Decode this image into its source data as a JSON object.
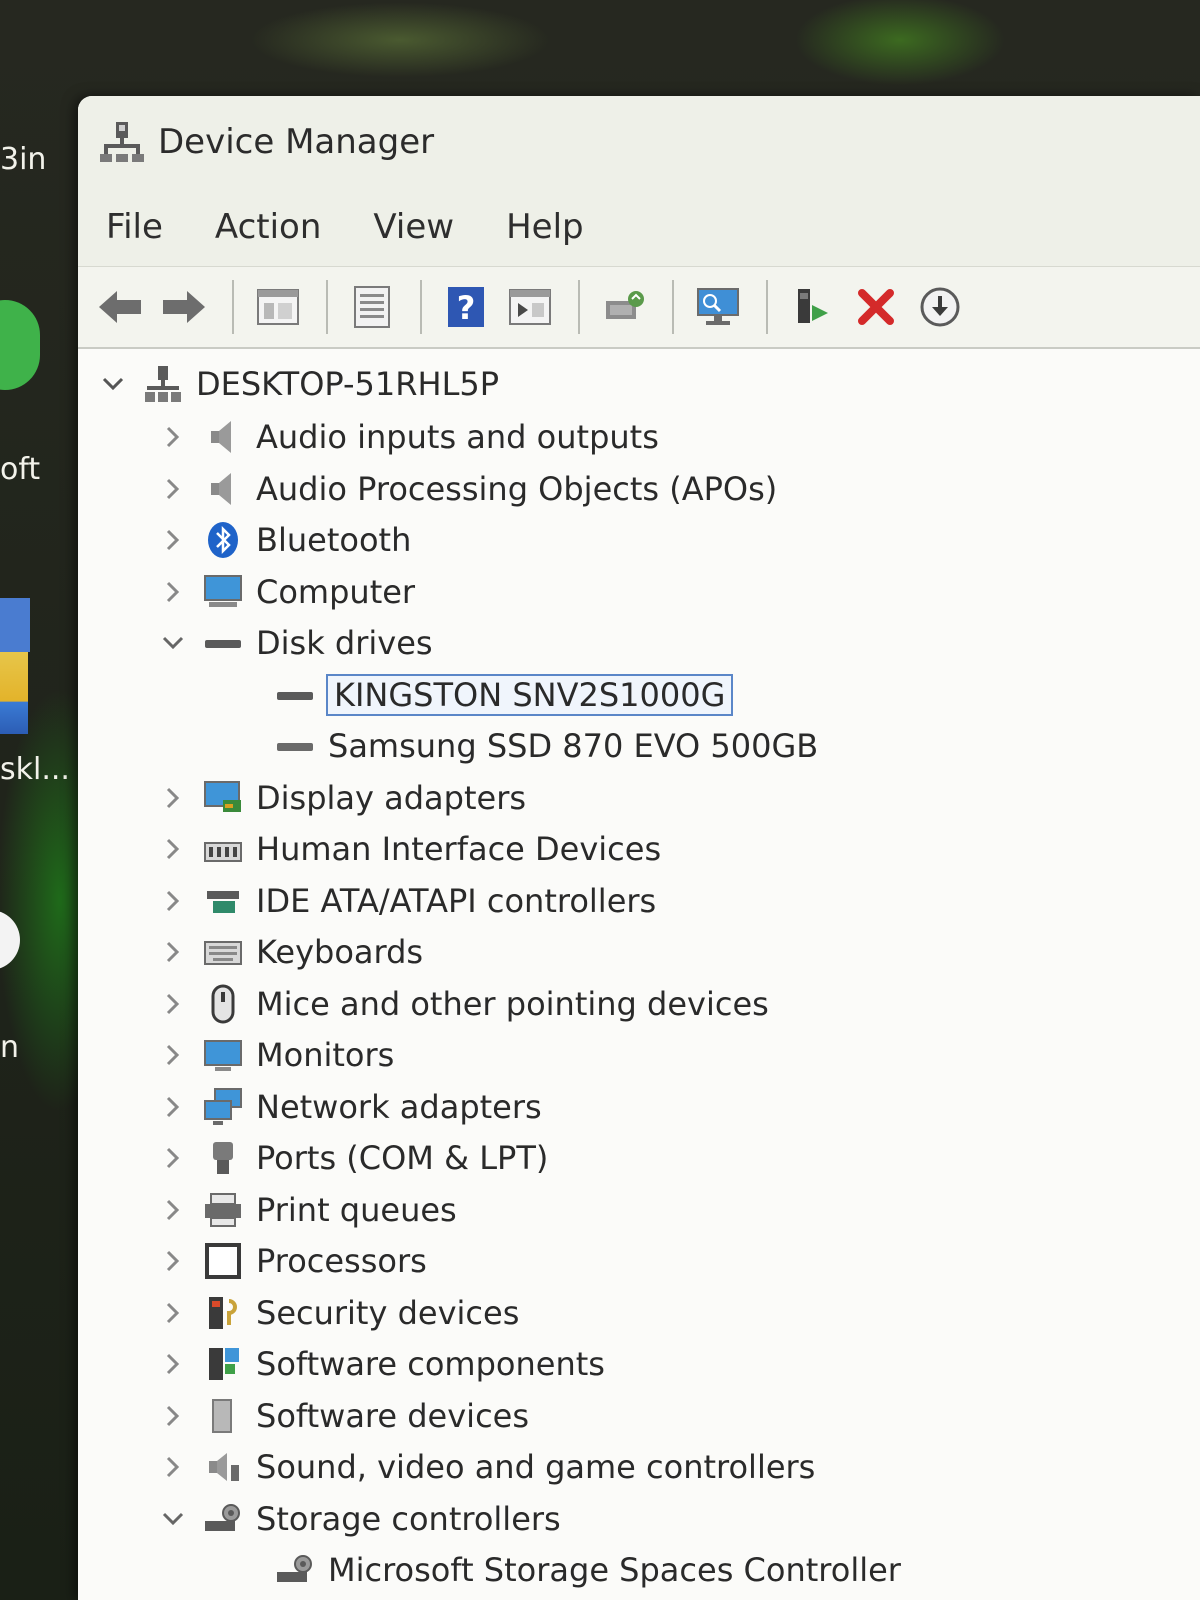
{
  "desktop": {
    "labels": [
      "3in",
      "oft",
      "skl...",
      "n"
    ]
  },
  "window": {
    "title": "Device Manager"
  },
  "menu": {
    "file": "File",
    "action": "Action",
    "view": "View",
    "help": "Help"
  },
  "toolbar": {
    "icons": [
      "back-arrow-icon",
      "forward-arrow-icon",
      "show-hide-tree-icon",
      "properties-icon",
      "help-icon",
      "run-icon",
      "update-driver-icon",
      "scan-hardware-icon",
      "add-legacy-icon",
      "uninstall-icon",
      "download-icon"
    ]
  },
  "tree": {
    "root": "DESKTOP-51RHL5P",
    "items": [
      {
        "label": "Audio inputs and outputs",
        "expanded": false
      },
      {
        "label": "Audio Processing Objects (APOs)",
        "expanded": false
      },
      {
        "label": "Bluetooth",
        "expanded": false
      },
      {
        "label": "Computer",
        "expanded": false
      },
      {
        "label": "Disk drives",
        "expanded": true
      },
      {
        "label": "KINGSTON SNV2S1000G",
        "child": true,
        "selected": true
      },
      {
        "label": "Samsung SSD 870 EVO 500GB",
        "child": true
      },
      {
        "label": "Display adapters",
        "expanded": false
      },
      {
        "label": "Human Interface Devices",
        "expanded": false
      },
      {
        "label": "IDE ATA/ATAPI controllers",
        "expanded": false
      },
      {
        "label": "Keyboards",
        "expanded": false
      },
      {
        "label": "Mice and other pointing devices",
        "expanded": false
      },
      {
        "label": "Monitors",
        "expanded": false
      },
      {
        "label": "Network adapters",
        "expanded": false
      },
      {
        "label": "Ports (COM & LPT)",
        "expanded": false
      },
      {
        "label": "Print queues",
        "expanded": false
      },
      {
        "label": "Processors",
        "expanded": false
      },
      {
        "label": "Security devices",
        "expanded": false
      },
      {
        "label": "Software components",
        "expanded": false
      },
      {
        "label": "Software devices",
        "expanded": false
      },
      {
        "label": "Sound, video and game controllers",
        "expanded": false
      },
      {
        "label": "Storage controllers",
        "expanded": true
      },
      {
        "label": "Microsoft Storage Spaces Controller",
        "child": true
      }
    ]
  }
}
